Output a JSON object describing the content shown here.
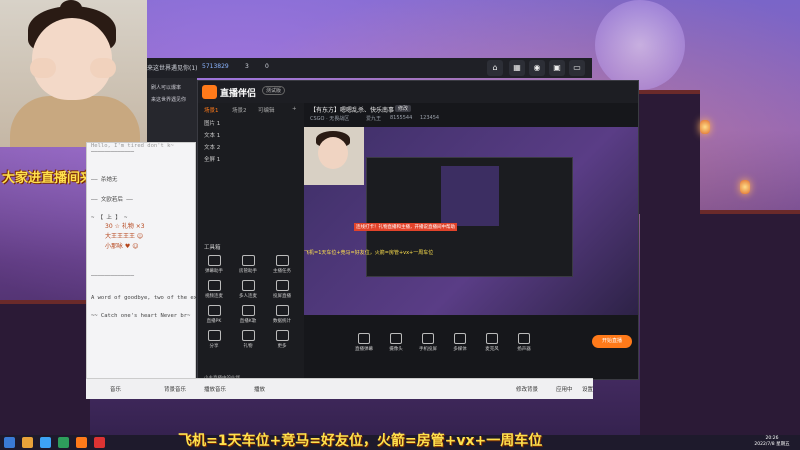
{
  "webcam": {
    "banner": "大家进直播间来玩，冒冒"
  },
  "behind_window": {
    "title_left": "来这世界遇见你(1)",
    "viewer_count": "5713829",
    "count2": "3",
    "badge": "0"
  },
  "old_window": {
    "lines": [
      "刷人可以爆率",
      "来这世界遇见你"
    ]
  },
  "app": {
    "logo": "直播伴侣",
    "version": "测试版",
    "sidebar_tabs": [
      "场景1",
      "场景2",
      "可编辑"
    ],
    "sources": [
      "图片 1",
      "文本 1",
      "文本 2",
      "全屏 1"
    ],
    "tools_header": "工具箱",
    "tools": [
      "弹幕助手",
      "房管助手",
      "主播任务",
      "视频连麦",
      "多人连麦",
      "投屏直播",
      "直播PK",
      "直播K歌",
      "数据统计",
      "分享",
      "礼物",
      "更多"
    ],
    "sidebar_note": "小主直播中的伙伴",
    "room_title": "【有东方】嗯嗯乱杀、快乐南事",
    "room_tag": "修改",
    "room_meta": [
      "CSGO · 无畏战区",
      "爱九王",
      "8155544",
      "123454"
    ],
    "preview_red": "连线打卡！礼物直播和主播，开播说直播间中帮助",
    "preview_strip": "飞机=1天车位+竞马=好友位，火箭=房管+vx+一周车位",
    "controls": [
      "直播弹幕",
      "摄像头",
      "手机投屏",
      "多媒体",
      "麦克风",
      "扬声器"
    ],
    "golive": "开始直播"
  },
  "chat": {
    "lines": [
      "—————————————",
      "Hello, I'm tired don't k~",
      "—— 杀她无",
      "—— 文欧若后 ——",
      "~ 【 上 】 ~",
      "",
      "—————————————",
      "A word of goodbye, two of the ex~",
      "",
      "~~ Catch one's heart Never br~"
    ],
    "gifts": [
      "30 ☆ 礼物 ×3",
      "大王王王王 ☺",
      "小那咏 ♥ ☺"
    ],
    "bottom": [
      "音乐",
      "背景音乐",
      "播放音乐",
      "播放"
    ]
  },
  "bottom_ticker": "飞机=1天车位+竞马=好友位，火箭=房管+vx+一周车位",
  "botbar_right": [
    "修改背景",
    "应用中",
    "设置"
  ],
  "clock": {
    "time": "20:26",
    "date": "2022/7/8 星期五"
  }
}
